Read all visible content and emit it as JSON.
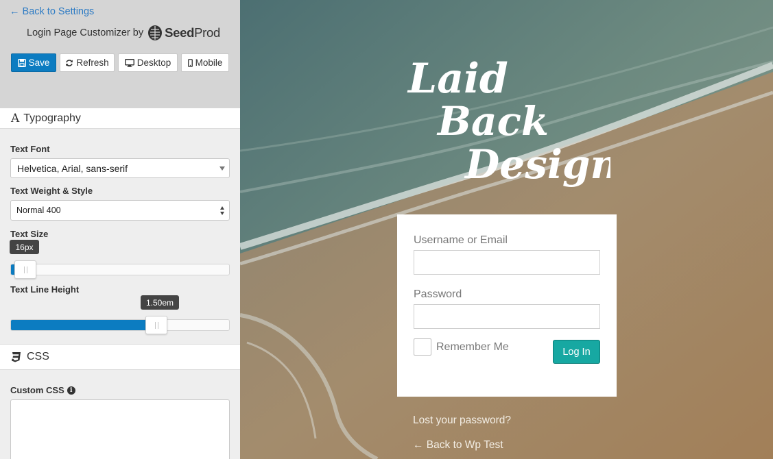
{
  "sidebar": {
    "back_link": "← Back to Settings",
    "brand_text": "Login Page Customizer by",
    "brand_logo_name_bold": "Seed",
    "brand_logo_name_thin": "Prod",
    "buttons": {
      "save": "Save",
      "refresh": "Refresh",
      "desktop": "Desktop",
      "mobile": "Mobile"
    },
    "typography": {
      "title": "Typography",
      "text_font_label": "Text Font",
      "text_font_value": "Helvetica, Arial, sans-serif",
      "text_weight_label": "Text Weight & Style",
      "text_weight_value": "Normal 400",
      "text_size_label": "Text Size",
      "text_size_value": "16px",
      "text_size_fraction": 0.02,
      "line_height_label": "Text Line Height",
      "line_height_value": "1.50em",
      "line_height_fraction": 0.66
    },
    "css": {
      "title": "CSS",
      "custom_css_label": "Custom CSS"
    }
  },
  "preview": {
    "logo_lines": [
      "Laid",
      "Back",
      "Designs"
    ],
    "username_label": "Username or Email",
    "password_label": "Password",
    "remember_label": "Remember Me",
    "login_button": "Log In",
    "lost_password": "Lost your password?",
    "back_to_site": "← Back to Wp Test"
  },
  "colors": {
    "accent": "#0c7cc1",
    "login_button": "#17a8a2",
    "link": "#2f7cc4"
  }
}
